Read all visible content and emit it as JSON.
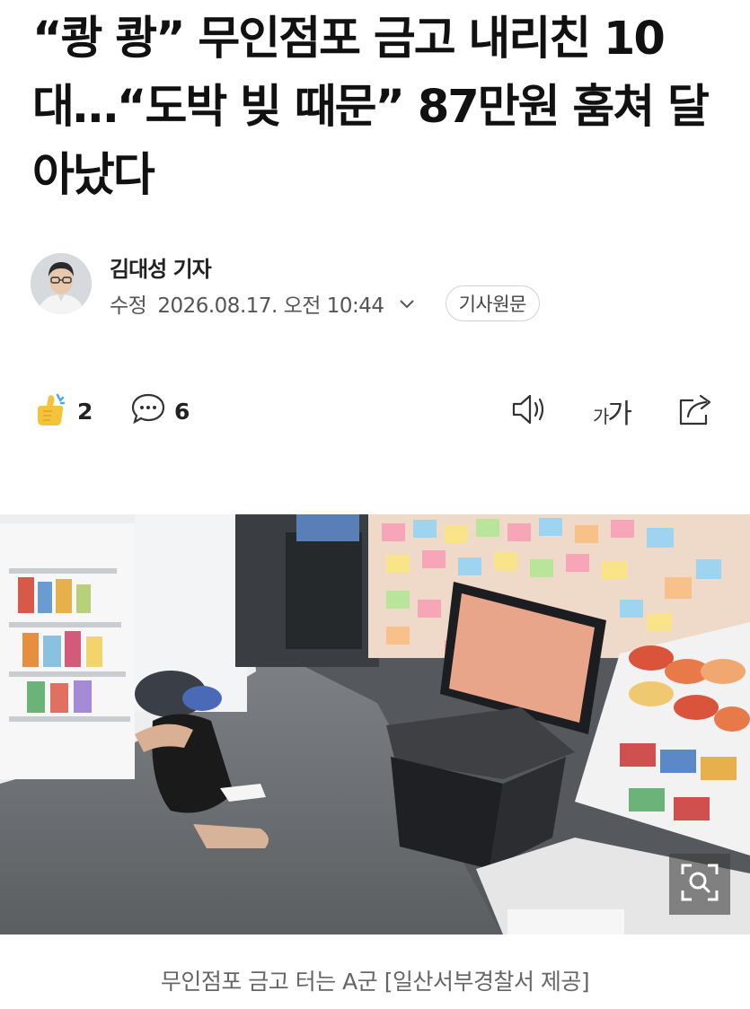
{
  "article": {
    "headline": "“쾅 쾅” 무인점포 금고 내리친 10대…“도박 빚 때문” 87만원 훔쳐 달아났다"
  },
  "byline": {
    "reporter": "김대성 기자",
    "modified_label": "수정",
    "datetime": "2026.08.17. 오전 10:44",
    "original_button": "기사원문"
  },
  "actions": {
    "likes": "2",
    "comments": "6",
    "font_size_small": "가",
    "font_size_large": "가"
  },
  "photo": {
    "caption": "무인점포 금고 터는 A군 [일산서부경찰서 제공]"
  },
  "icons": {
    "like": "thumbs-up-icon",
    "comment": "speech-bubble-icon",
    "listen": "speaker-icon",
    "font": "font-size-icon",
    "share": "share-icon",
    "zoom": "zoom-expand-icon",
    "expand": "chevron-down-icon"
  },
  "colors": {
    "like_yellow": "#f5c33b",
    "like_accent": "#4aa3f0",
    "border": "#cfd3d8",
    "caption": "#666666"
  }
}
